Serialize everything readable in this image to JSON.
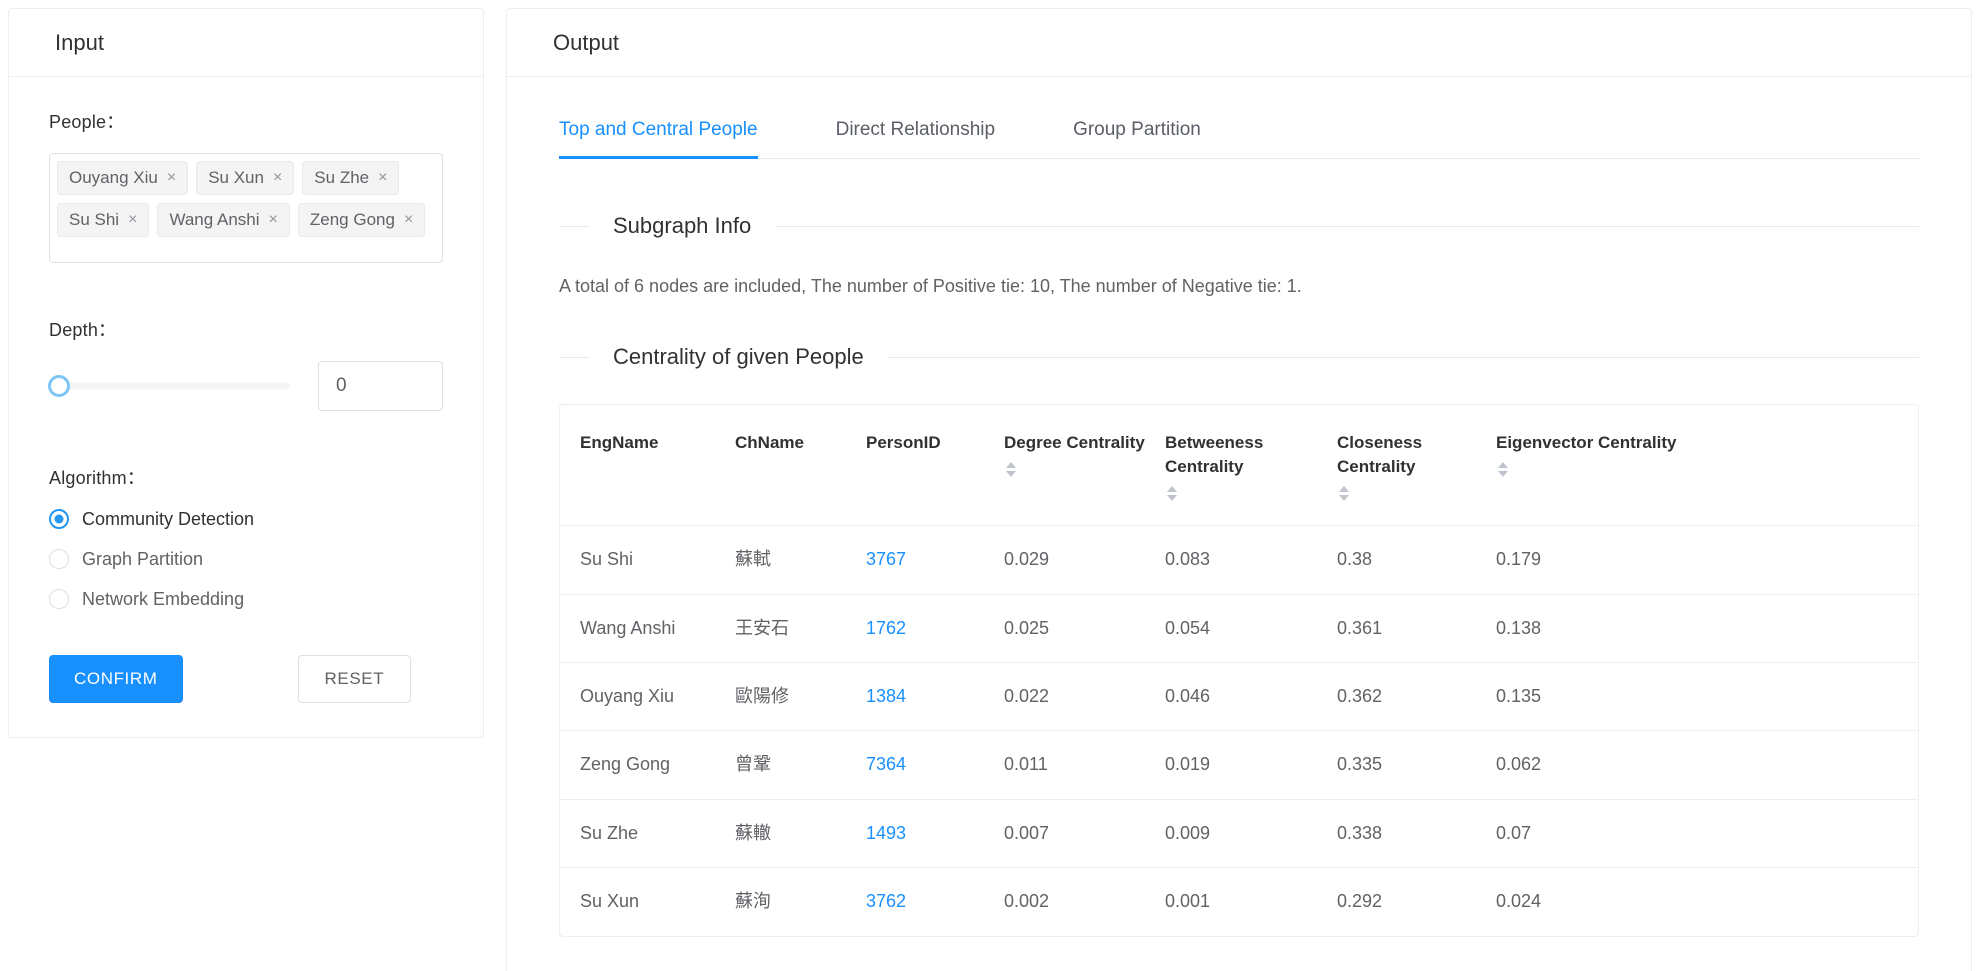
{
  "input": {
    "title": "Input",
    "people_label": "People：",
    "tags": [
      {
        "label": "Ouyang Xiu",
        "close": "×"
      },
      {
        "label": "Su Xun",
        "close": "×"
      },
      {
        "label": "Su Zhe",
        "close": "×"
      },
      {
        "label": "Su Shi",
        "close": "×"
      },
      {
        "label": "Wang Anshi",
        "close": "×"
      },
      {
        "label": "Zeng Gong",
        "close": "×"
      }
    ],
    "depth_label": "Depth：",
    "depth_value": "0",
    "algorithm_label": "Algorithm：",
    "algorithms": [
      {
        "label": "Community Detection",
        "selected": true
      },
      {
        "label": "Graph Partition",
        "selected": false
      },
      {
        "label": "Network Embedding",
        "selected": false
      }
    ],
    "confirm_label": "CONFIRM",
    "reset_label": "RESET"
  },
  "output": {
    "title": "Output",
    "tabs": [
      {
        "label": "Top and Central People",
        "active": true
      },
      {
        "label": "Direct Relationship",
        "active": false
      },
      {
        "label": "Group Partition",
        "active": false
      }
    ],
    "subgraph_heading": "Subgraph Info",
    "subgraph_info": "A total of 6 nodes are included, The number of Positive tie: 10, The number of Negative tie: 1.",
    "centrality_heading": "Centrality of given People",
    "table": {
      "columns": [
        {
          "label": "EngName",
          "sortable": false
        },
        {
          "label": "ChName",
          "sortable": false
        },
        {
          "label": "PersonID",
          "sortable": false
        },
        {
          "label": "Degree Centrality",
          "sortable": true
        },
        {
          "label": "Betweeness Centrality",
          "sortable": true
        },
        {
          "label": "Closeness Centrality",
          "sortable": true
        },
        {
          "label": "Eigenvector Centrality",
          "sortable": true
        }
      ],
      "rows": [
        {
          "eng": "Su Shi",
          "ch": "蘇軾",
          "pid": "3767",
          "degree": "0.029",
          "betweeness": "0.083",
          "closeness": "0.38",
          "eigenvector": "0.179"
        },
        {
          "eng": "Wang Anshi",
          "ch": "王安石",
          "pid": "1762",
          "degree": "0.025",
          "betweeness": "0.054",
          "closeness": "0.361",
          "eigenvector": "0.138"
        },
        {
          "eng": "Ouyang Xiu",
          "ch": "歐陽修",
          "pid": "1384",
          "degree": "0.022",
          "betweeness": "0.046",
          "closeness": "0.362",
          "eigenvector": "0.135"
        },
        {
          "eng": "Zeng Gong",
          "ch": "曾鞏",
          "pid": "7364",
          "degree": "0.011",
          "betweeness": "0.019",
          "closeness": "0.335",
          "eigenvector": "0.062"
        },
        {
          "eng": "Su Zhe",
          "ch": "蘇轍",
          "pid": "1493",
          "degree": "0.007",
          "betweeness": "0.009",
          "closeness": "0.338",
          "eigenvector": "0.07"
        },
        {
          "eng": "Su Xun",
          "ch": "蘇洵",
          "pid": "3762",
          "degree": "0.002",
          "betweeness": "0.001",
          "closeness": "0.292",
          "eigenvector": "0.024"
        }
      ]
    }
  },
  "colors": {
    "accent": "#1890ff",
    "link": "#1890ff",
    "border": "#ebeef5",
    "text": "#303133",
    "muted": "#606266"
  }
}
